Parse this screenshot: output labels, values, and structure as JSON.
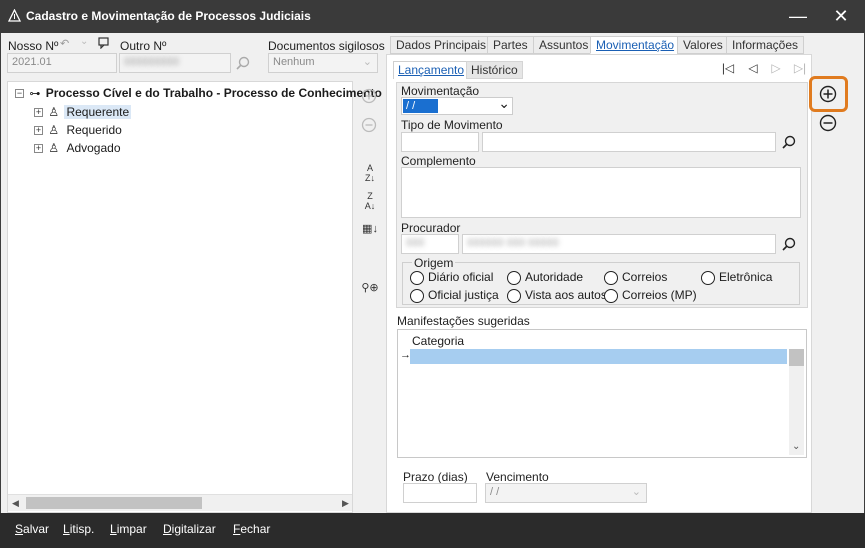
{
  "window": {
    "title": "Cadastro e Movimentação de Processos Judiciais",
    "minimize_glyph": "—",
    "close_glyph": "✕"
  },
  "header": {
    "nosso_label": "Nosso Nº",
    "nosso_value": "2021.01",
    "outro_label": "Outro Nº",
    "docs_label": "Documentos sigilosos",
    "docs_value": "Nenhum"
  },
  "tree": {
    "root": "Processo Cível e do Trabalho - Processo de Conhecimento",
    "items": [
      "Requerente",
      "Requerido",
      "Advogado"
    ]
  },
  "tabs": [
    "Dados Principais",
    "Partes",
    "Assuntos",
    "Movimentação",
    "Valores",
    "Informações"
  ],
  "subtabs": [
    "Lançamento",
    "Histórico"
  ],
  "form": {
    "movimentacao_label": "Movimentação",
    "movimentacao_value": " / /",
    "tipo_label": "Tipo de Movimento",
    "complemento_label": "Complemento",
    "procurador_label": "Procurador",
    "origem_label": "Origem",
    "origem_options": [
      "Diário oficial",
      "Autoridade",
      "Correios",
      "Eletrônica",
      "Oficial justiça",
      "Vista aos autos",
      "Correios (MP)"
    ]
  },
  "manifest": {
    "label": "Manifestações sugeridas",
    "column": "Categoria"
  },
  "bottom": {
    "prazo_label": "Prazo (dias)",
    "vencimento_label": "Vencimento",
    "vencimento_value": " / /"
  },
  "footer": [
    {
      "u": "S",
      "rest": "alvar"
    },
    {
      "u": "L",
      "rest": "itisp."
    },
    {
      "u": "L",
      "rest": "impar"
    },
    {
      "u": "D",
      "rest": "igitalizar"
    },
    {
      "u": "F",
      "rest": "echar"
    }
  ],
  "colors": {
    "accent": "#1a5fb4",
    "highlight": "#e07b1f",
    "selection": "#a6cdf0"
  }
}
